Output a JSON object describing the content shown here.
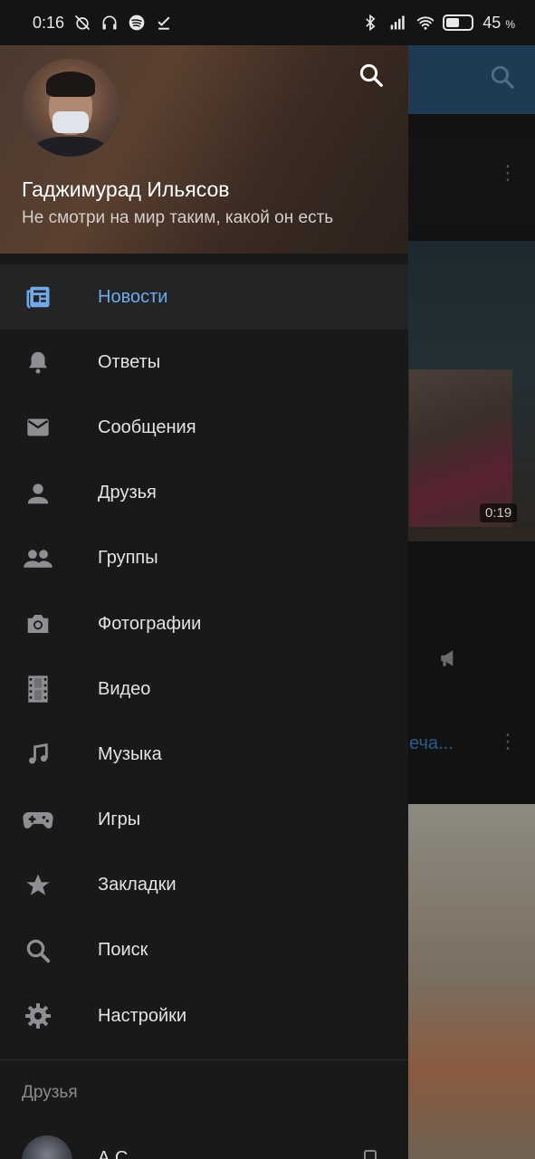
{
  "status_bar": {
    "time": "0:16",
    "battery_percent": "45",
    "battery_unit": "%"
  },
  "profile": {
    "name": "Гаджимурад Ильясов",
    "status": "Не смотри на мир таким, какой он есть"
  },
  "menu": {
    "items": [
      {
        "label": "Новости",
        "icon": "newspaper-icon",
        "active": true
      },
      {
        "label": "Ответы",
        "icon": "bell-icon"
      },
      {
        "label": "Сообщения",
        "icon": "envelope-icon"
      },
      {
        "label": "Друзья",
        "icon": "person-icon"
      },
      {
        "label": "Группы",
        "icon": "people-icon"
      },
      {
        "label": "Фотографии",
        "icon": "camera-icon"
      },
      {
        "label": "Видео",
        "icon": "film-icon"
      },
      {
        "label": "Музыка",
        "icon": "music-note-icon"
      },
      {
        "label": "Игры",
        "icon": "gamepad-icon"
      },
      {
        "label": "Закладки",
        "icon": "star-icon"
      },
      {
        "label": "Поиск",
        "icon": "search-icon"
      },
      {
        "label": "Настройки",
        "icon": "gear-icon"
      }
    ]
  },
  "friends_section": {
    "title": "Друзья",
    "first_friend_name": "А          С"
  },
  "background_feed": {
    "video_duration": "0:19",
    "link_fragment": "еча..."
  },
  "colors": {
    "accent": "#71aaeb",
    "drawer_bg": "#191919",
    "active_row_bg": "#232425",
    "icon_gray": "#8d8f93"
  }
}
